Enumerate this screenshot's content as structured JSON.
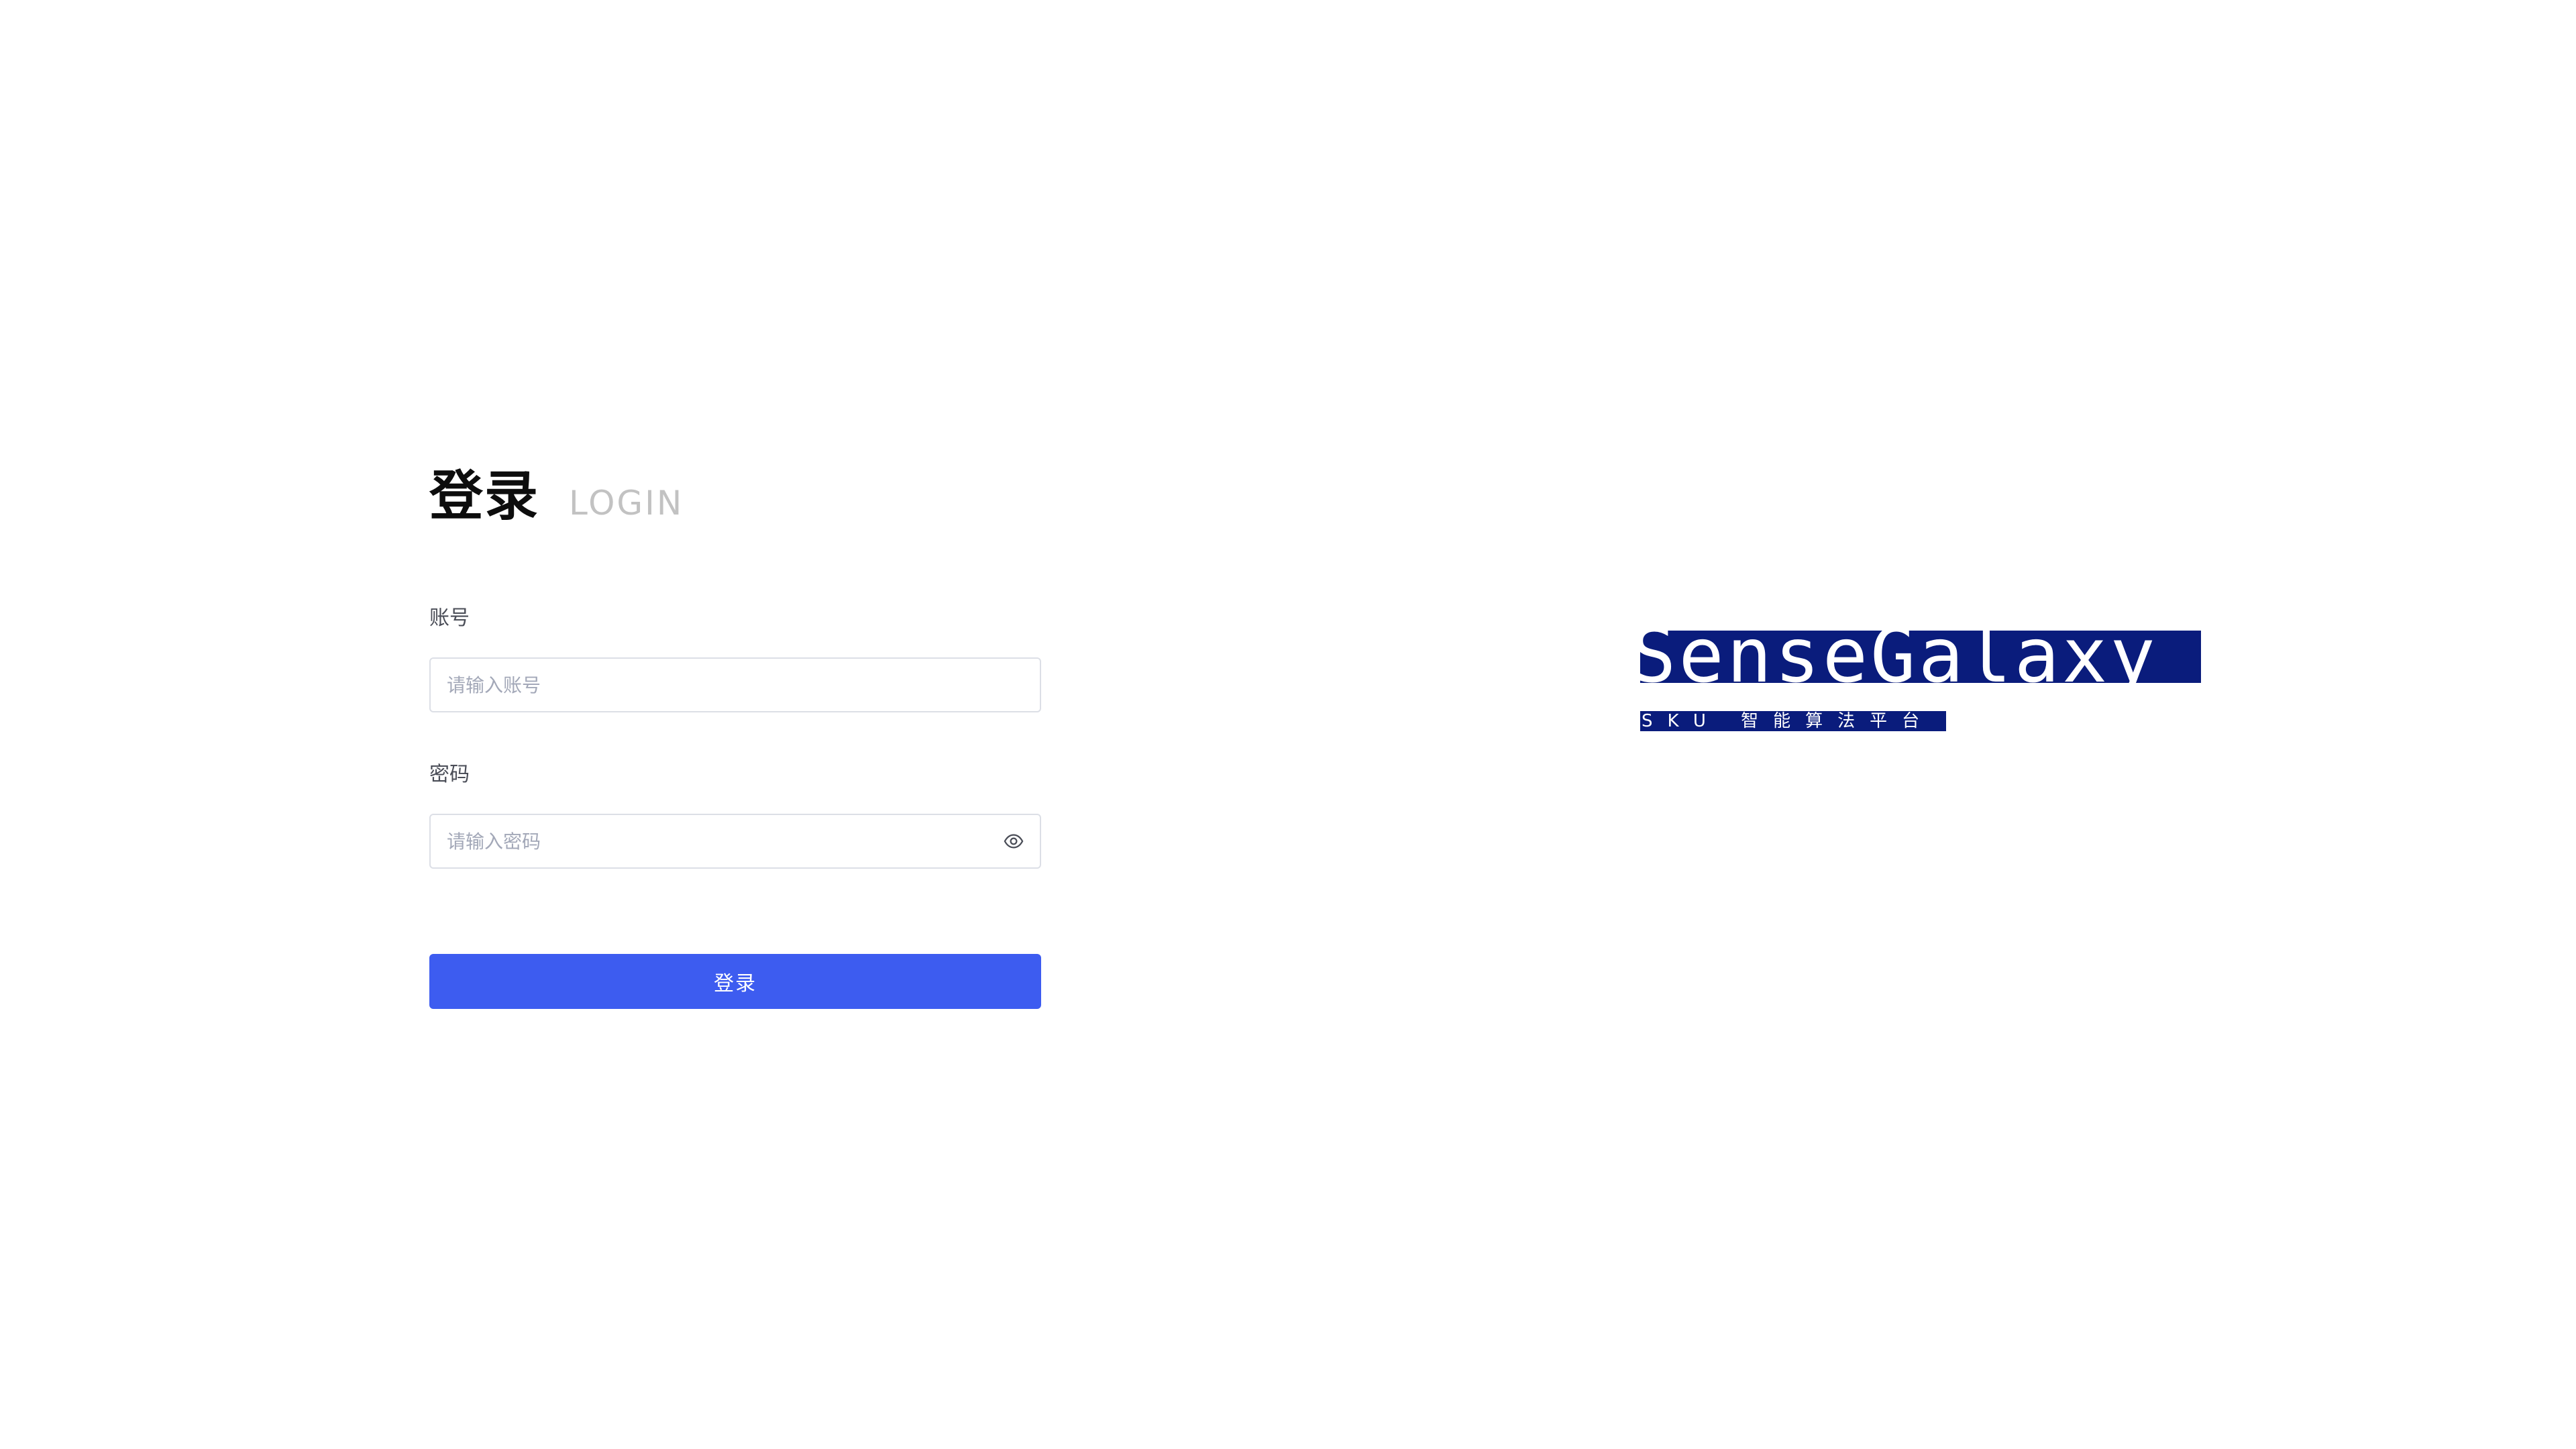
{
  "login": {
    "title": "登录",
    "title_en": "LOGIN",
    "account": {
      "label": "账号",
      "placeholder": "请输入账号",
      "value": ""
    },
    "password": {
      "label": "密码",
      "placeholder": "请输入密码",
      "value": ""
    },
    "submit_label": "登录"
  },
  "brand": {
    "wordmark": "SenseGalaxy",
    "tagline": "SKU 智能算法平台"
  },
  "icons": {
    "password_toggle": "eye-icon"
  },
  "colors": {
    "primary_button": "#3d5cf0",
    "brand_navy": "#0a1c7c",
    "title_secondary": "#c2c2c2",
    "placeholder": "#a3a8b8"
  }
}
